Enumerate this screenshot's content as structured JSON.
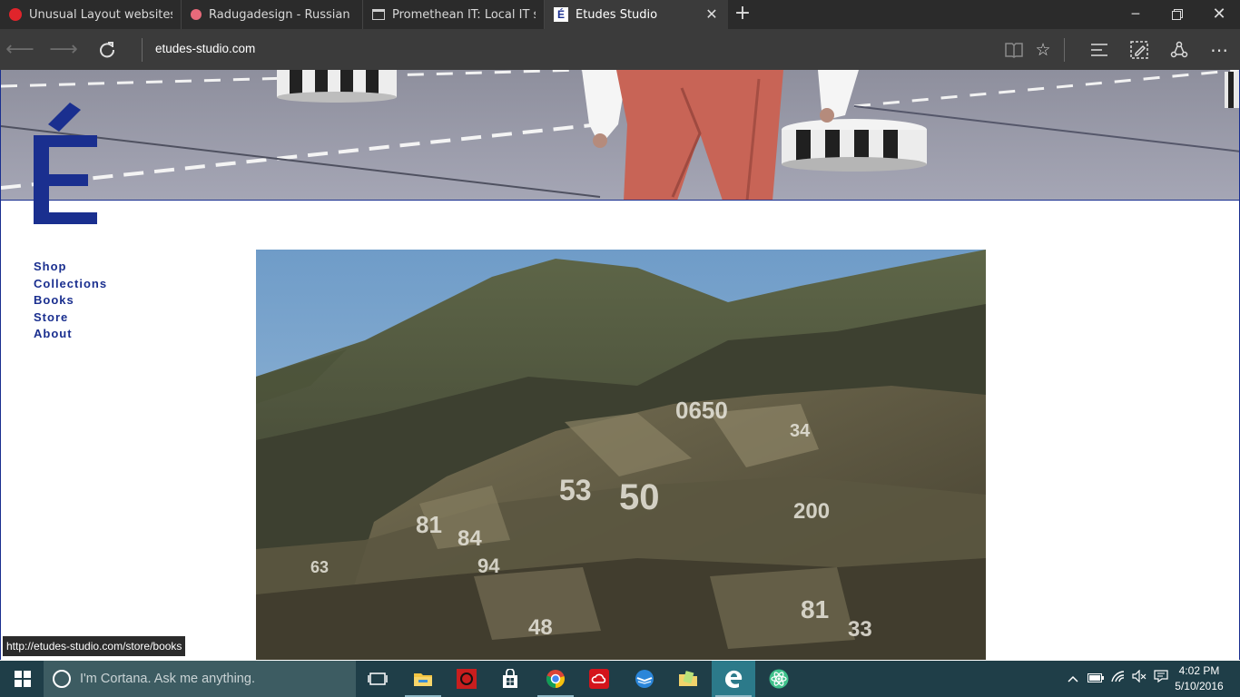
{
  "browser": {
    "tabs": [
      {
        "label": "Unusual Layout websites, pa",
        "icon": "red-circle-icon",
        "color": "#e0242b"
      },
      {
        "label": "Radugadesign - Russian me",
        "icon": "pink-circle-icon",
        "color": "#e86a7a"
      },
      {
        "label": "Promethean IT: Local IT supp",
        "icon": "page-icon"
      },
      {
        "label": "Études Studio",
        "icon": "etudes-favicon",
        "active": true
      }
    ],
    "favicon_letter": "É",
    "url": "etudes-studio.com",
    "status_link": "http://etudes-studio.com/store/books"
  },
  "site": {
    "brand_color": "#1a2f8f",
    "logo_letter": "É",
    "nav": [
      {
        "label": "Shop"
      },
      {
        "label": "Collections"
      },
      {
        "label": "Books"
      },
      {
        "label": "Store"
      },
      {
        "label": "About"
      }
    ],
    "photo_numbers": [
      "0650",
      "34",
      "53",
      "50",
      "200",
      "81",
      "84",
      "48",
      "94",
      "63",
      "81",
      "33"
    ]
  },
  "taskbar": {
    "cortana_placeholder": "I'm Cortana. Ask me anything.",
    "apps": [
      "task-view-icon",
      "file-explorer-icon",
      "app-red-icon",
      "store-icon",
      "chrome-icon",
      "creative-cloud-icon",
      "thunderbird-icon",
      "folder-notes-icon",
      "edge-icon",
      "atom-icon"
    ],
    "time": "4:02 PM",
    "date": "5/10/2016"
  }
}
